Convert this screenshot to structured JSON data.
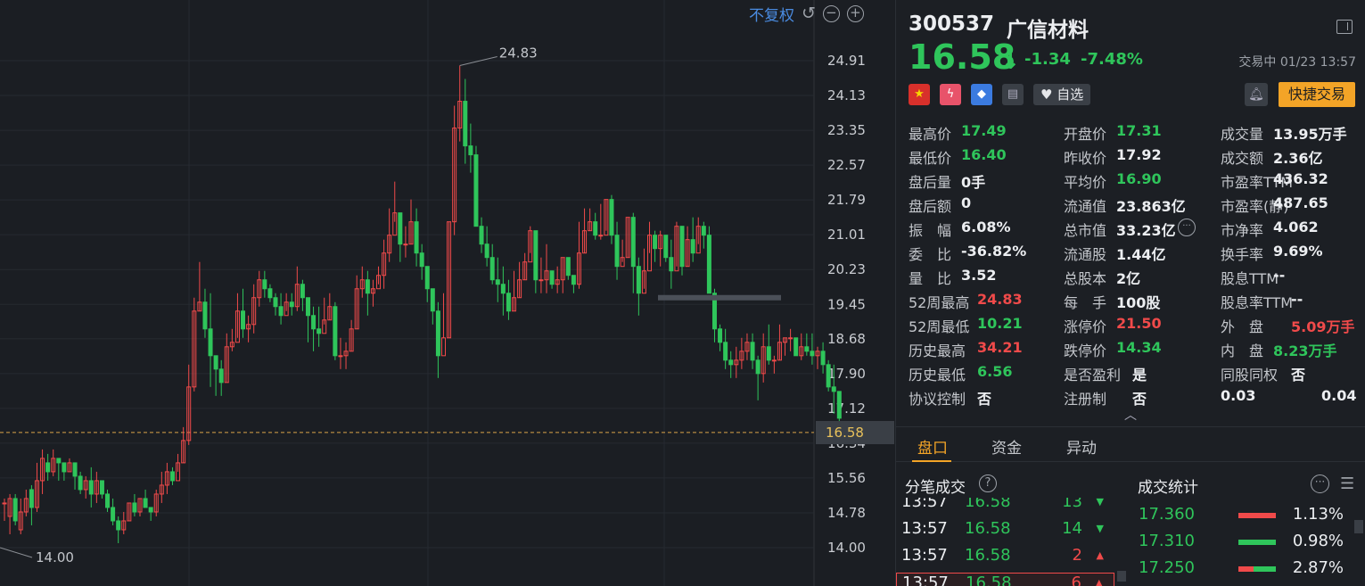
{
  "chart": {
    "adjust_label": "不复权",
    "y_ticks": [
      "24.91",
      "24.13",
      "23.35",
      "22.57",
      "21.79",
      "21.01",
      "20.23",
      "19.45",
      "18.68",
      "17.90",
      "17.12",
      "16.34",
      "15.56",
      "14.78",
      "14.00"
    ],
    "current_price_tag": "16.58",
    "high_annot": "24.83",
    "low_annot": "14.00",
    "up_color": "#f04a4a",
    "down_color": "#2fc55b"
  },
  "chart_data": {
    "type": "candlestick",
    "y_range": [
      14.0,
      24.91
    ],
    "candles": [
      [
        15.0,
        15.0,
        14.6,
        15.1
      ],
      [
        14.7,
        15.1,
        14.3,
        15.2
      ],
      [
        15.1,
        14.6,
        14.5,
        15.2
      ],
      [
        14.4,
        14.8,
        14.3,
        15.1
      ],
      [
        14.8,
        15.1,
        14.7,
        15.3
      ],
      [
        15.3,
        14.9,
        14.5,
        15.4
      ],
      [
        14.9,
        15.5,
        14.8,
        15.9
      ],
      [
        15.5,
        16.0,
        15.2,
        16.2
      ],
      [
        15.9,
        15.7,
        15.5,
        16.1
      ],
      [
        15.7,
        16.0,
        15.6,
        16.2
      ],
      [
        16.0,
        15.9,
        15.5,
        16.0
      ],
      [
        15.9,
        15.7,
        15.5,
        15.9
      ],
      [
        15.7,
        15.9,
        15.7,
        16.0
      ],
      [
        15.9,
        15.6,
        15.3,
        15.9
      ],
      [
        15.6,
        15.3,
        15.2,
        15.7
      ],
      [
        15.3,
        15.5,
        15.1,
        15.6
      ],
      [
        15.5,
        15.2,
        14.9,
        15.8
      ],
      [
        15.2,
        15.5,
        15.0,
        15.7
      ],
      [
        15.5,
        15.2,
        15.1,
        15.5
      ],
      [
        15.2,
        14.9,
        14.8,
        15.3
      ],
      [
        14.9,
        14.6,
        14.5,
        15.1
      ],
      [
        14.6,
        14.4,
        14.1,
        14.7
      ],
      [
        14.4,
        14.6,
        14.3,
        14.8
      ],
      [
        14.6,
        15.0,
        14.6,
        15.0
      ],
      [
        15.0,
        14.8,
        14.7,
        15.2
      ],
      [
        14.8,
        15.1,
        14.7,
        15.1
      ],
      [
        15.1,
        14.9,
        14.9,
        15.3
      ],
      [
        14.9,
        14.8,
        14.6,
        14.9
      ],
      [
        14.8,
        15.2,
        14.7,
        15.3
      ],
      [
        15.2,
        15.4,
        15.0,
        15.7
      ],
      [
        15.4,
        15.7,
        15.2,
        15.9
      ],
      [
        15.7,
        15.5,
        15.4,
        15.8
      ],
      [
        15.5,
        15.9,
        15.7,
        16.1
      ],
      [
        15.9,
        16.4,
        15.9,
        16.7
      ],
      [
        16.4,
        17.6,
        16.3,
        18.1
      ],
      [
        17.6,
        19.3,
        17.5,
        19.6
      ],
      [
        19.3,
        19.5,
        19.3,
        20.4
      ],
      [
        19.5,
        18.9,
        18.7,
        19.8
      ],
      [
        18.9,
        18.3,
        17.6,
        19.7
      ],
      [
        18.3,
        18.0,
        17.4,
        18.3
      ],
      [
        18.0,
        17.7,
        17.4,
        18.2
      ],
      [
        17.7,
        18.5,
        17.7,
        18.8
      ],
      [
        18.5,
        18.6,
        18.4,
        18.9
      ],
      [
        18.6,
        19.3,
        18.7,
        19.7
      ],
      [
        19.3,
        18.9,
        18.7,
        19.8
      ],
      [
        18.9,
        19.0,
        18.6,
        19.2
      ],
      [
        19.0,
        19.6,
        18.8,
        19.9
      ],
      [
        19.6,
        20.0,
        19.4,
        20.2
      ],
      [
        20.0,
        19.8,
        19.6,
        20.2
      ],
      [
        19.8,
        19.6,
        19.5,
        19.9
      ],
      [
        19.6,
        19.4,
        19.2,
        19.7
      ],
      [
        19.4,
        19.2,
        19.0,
        19.7
      ],
      [
        19.2,
        19.5,
        19.3,
        19.7
      ],
      [
        19.5,
        19.4,
        19.2,
        19.7
      ],
      [
        19.4,
        19.9,
        19.3,
        20.3
      ],
      [
        19.9,
        19.6,
        19.3,
        20.0
      ],
      [
        19.6,
        19.2,
        18.6,
        19.6
      ],
      [
        19.2,
        18.9,
        18.4,
        19.4
      ],
      [
        18.9,
        18.8,
        18.5,
        19.4
      ],
      [
        18.8,
        19.1,
        19.0,
        19.6
      ],
      [
        19.1,
        19.4,
        19.1,
        19.7
      ],
      [
        19.4,
        18.3,
        18.2,
        19.5
      ],
      [
        18.3,
        18.3,
        18.0,
        18.7
      ],
      [
        18.3,
        18.4,
        18.0,
        18.6
      ],
      [
        18.4,
        18.9,
        18.4,
        19.1
      ],
      [
        18.9,
        19.8,
        18.9,
        20.1
      ],
      [
        19.8,
        20.0,
        19.6,
        20.3
      ],
      [
        20.0,
        19.7,
        19.2,
        20.2
      ],
      [
        19.7,
        19.8,
        19.4,
        20.0
      ],
      [
        19.8,
        20.1,
        19.9,
        20.3
      ],
      [
        20.1,
        20.6,
        19.8,
        20.9
      ],
      [
        20.6,
        21.0,
        20.4,
        21.6
      ],
      [
        21.0,
        21.5,
        21.3,
        22.2
      ],
      [
        21.5,
        20.8,
        20.4,
        21.5
      ],
      [
        20.8,
        20.8,
        20.5,
        21.2
      ],
      [
        20.8,
        21.3,
        20.8,
        21.8
      ],
      [
        21.3,
        20.6,
        20.3,
        21.6
      ],
      [
        20.6,
        20.3,
        20.0,
        20.8
      ],
      [
        20.3,
        19.8,
        19.5,
        20.3
      ],
      [
        19.8,
        19.3,
        19.0,
        19.8
      ],
      [
        19.3,
        18.3,
        17.8,
        19.5
      ],
      [
        18.3,
        18.7,
        18.7,
        19.7
      ],
      [
        18.7,
        21.3,
        18.7,
        21.3
      ],
      [
        21.3,
        23.4,
        21.0,
        23.9
      ],
      [
        23.4,
        24.0,
        23.1,
        24.8
      ],
      [
        24.0,
        23.0,
        22.6,
        24.5
      ],
      [
        23.0,
        22.8,
        22.4,
        23.5
      ],
      [
        22.8,
        21.2,
        21.2,
        23.0
      ],
      [
        21.2,
        20.8,
        20.6,
        21.4
      ],
      [
        20.8,
        20.5,
        20.3,
        21.2
      ],
      [
        20.5,
        20.0,
        19.9,
        20.8
      ],
      [
        20.0,
        19.9,
        19.5,
        20.5
      ],
      [
        19.9,
        19.7,
        19.2,
        20.3
      ],
      [
        19.7,
        19.3,
        19.1,
        20.0
      ],
      [
        19.3,
        19.6,
        19.3,
        20.2
      ],
      [
        19.6,
        20.0,
        19.6,
        20.4
      ],
      [
        20.0,
        20.4,
        20.0,
        20.6
      ],
      [
        20.4,
        21.1,
        20.6,
        21.2
      ],
      [
        21.1,
        20.0,
        19.7,
        21.1
      ],
      [
        20.0,
        20.0,
        19.7,
        20.5
      ],
      [
        20.0,
        20.2,
        19.7,
        20.8
      ],
      [
        20.2,
        19.9,
        19.8,
        20.2
      ],
      [
        19.9,
        20.0,
        19.7,
        20.3
      ],
      [
        20.0,
        20.5,
        19.7,
        20.5
      ],
      [
        20.5,
        20.1,
        20.0,
        20.5
      ],
      [
        20.1,
        19.9,
        19.7,
        20.1
      ],
      [
        19.9,
        20.6,
        19.8,
        21.3
      ],
      [
        20.6,
        21.1,
        20.6,
        21.6
      ],
      [
        21.1,
        21.3,
        21.1,
        21.6
      ],
      [
        21.3,
        21.0,
        20.9,
        21.5
      ],
      [
        21.0,
        21.0,
        20.9,
        21.7
      ],
      [
        21.0,
        21.8,
        21.1,
        21.8
      ],
      [
        21.8,
        21.0,
        20.8,
        21.9
      ],
      [
        21.0,
        20.3,
        20.0,
        21.3
      ],
      [
        20.3,
        20.5,
        20.4,
        20.9
      ],
      [
        20.5,
        21.4,
        20.5,
        21.4
      ],
      [
        21.4,
        20.3,
        19.7,
        21.5
      ],
      [
        20.3,
        19.7,
        19.2,
        20.5
      ],
      [
        19.7,
        20.2,
        19.8,
        20.7
      ],
      [
        20.2,
        21.0,
        20.6,
        21.3
      ],
      [
        21.0,
        20.7,
        20.4,
        21.1
      ],
      [
        20.7,
        21.0,
        20.3,
        21.1
      ],
      [
        21.0,
        20.5,
        20.4,
        21.0
      ],
      [
        20.5,
        20.2,
        19.8,
        20.9
      ],
      [
        20.2,
        21.2,
        20.3,
        21.3
      ],
      [
        21.2,
        20.3,
        20.1,
        21.2
      ],
      [
        20.3,
        20.9,
        20.3,
        21.2
      ],
      [
        20.9,
        20.6,
        20.4,
        21.4
      ],
      [
        20.6,
        21.2,
        20.8,
        21.4
      ],
      [
        21.2,
        21.0,
        20.7,
        21.3
      ],
      [
        21.0,
        19.7,
        19.7,
        21.2
      ],
      [
        19.7,
        18.9,
        18.6,
        19.8
      ],
      [
        18.9,
        18.6,
        18.4,
        19.0
      ],
      [
        18.6,
        18.2,
        18.0,
        18.9
      ],
      [
        18.2,
        18.1,
        17.8,
        18.4
      ],
      [
        18.1,
        18.2,
        17.8,
        18.5
      ],
      [
        18.2,
        18.4,
        18.0,
        18.7
      ],
      [
        18.4,
        18.6,
        18.2,
        18.8
      ],
      [
        18.6,
        18.2,
        18.0,
        18.8
      ],
      [
        18.2,
        17.9,
        17.3,
        18.3
      ],
      [
        17.9,
        18.5,
        17.7,
        18.8
      ],
      [
        18.5,
        18.2,
        18.1,
        19.0
      ],
      [
        18.2,
        18.2,
        17.9,
        18.3
      ],
      [
        18.2,
        18.6,
        18.2,
        19.0
      ],
      [
        18.6,
        18.7,
        18.3,
        18.7
      ],
      [
        18.7,
        18.7,
        18.4,
        18.9
      ],
      [
        18.7,
        18.3,
        18.3,
        18.7
      ],
      [
        18.3,
        18.5,
        18.2,
        18.8
      ],
      [
        18.5,
        18.4,
        18.3,
        18.8
      ],
      [
        18.4,
        18.3,
        18.1,
        18.8
      ],
      [
        18.3,
        18.4,
        18.0,
        18.5
      ],
      [
        18.4,
        18.1,
        17.9,
        18.6
      ],
      [
        18.1,
        17.6,
        17.5,
        18.2
      ],
      [
        17.6,
        17.5,
        17.0,
        18.1
      ],
      [
        17.5,
        16.9,
        16.4,
        17.5
      ]
    ]
  },
  "stock": {
    "code": "300537",
    "name": "广信材料",
    "price": "16.58",
    "change": "-1.34",
    "change_pct": "-7.48%",
    "status": "交易中 01/23 13:57",
    "watch_label": "自选",
    "quick_trade_label": "快捷交易"
  },
  "stats": [
    [
      {
        "l": "最高价",
        "v": "17.49",
        "c": "g"
      },
      {
        "l": "开盘价",
        "v": "17.31",
        "c": "g"
      },
      {
        "l": "成交量",
        "v": "13.95万手",
        "c": ""
      }
    ],
    [
      {
        "l": "最低价",
        "v": "16.40",
        "c": "g"
      },
      {
        "l": "昨收价",
        "v": "17.92",
        "c": ""
      },
      {
        "l": "成交额",
        "v": "2.36亿",
        "c": ""
      }
    ],
    [
      {
        "l": "盘后量",
        "v": "0手",
        "c": ""
      },
      {
        "l": "平均价",
        "v": "16.90",
        "c": "g"
      },
      {
        "l": "市盈率TTM",
        "v": "436.32",
        "c": ""
      }
    ],
    [
      {
        "l": "盘后额",
        "v": "0",
        "c": ""
      },
      {
        "l": "流通值",
        "v": "23.863亿",
        "c": ""
      },
      {
        "l": "市盈率(静)",
        "v": "487.65",
        "c": ""
      }
    ],
    [
      {
        "l": "振　幅",
        "v": "6.08%",
        "c": ""
      },
      {
        "l": "总市值",
        "v": "33.23亿",
        "c": ""
      },
      {
        "l": "市净率",
        "v": "4.062",
        "c": ""
      }
    ],
    [
      {
        "l": "委　比",
        "v": "-36.82%",
        "c": ""
      },
      {
        "l": "流通股",
        "v": "1.44亿",
        "c": ""
      },
      {
        "l": "换手率",
        "v": "9.69%",
        "c": ""
      }
    ],
    [
      {
        "l": "量　比",
        "v": "3.52",
        "c": ""
      },
      {
        "l": "总股本",
        "v": "2亿",
        "c": ""
      },
      {
        "l": "股息TTM",
        "v": "--",
        "c": ""
      }
    ],
    [
      {
        "l": "52周最高",
        "v": "24.83",
        "c": "r"
      },
      {
        "l": "每　手",
        "v": "100股",
        "c": ""
      },
      {
        "l": "股息率TTM",
        "v": "--",
        "c": ""
      }
    ],
    [
      {
        "l": "52周最低",
        "v": "10.21",
        "c": "g"
      },
      {
        "l": "涨停价",
        "v": "21.50",
        "c": "r"
      },
      {
        "l": "外　盘",
        "v": "5.09万手",
        "c": "r"
      }
    ],
    [
      {
        "l": "历史最高",
        "v": "34.21",
        "c": "r"
      },
      {
        "l": "跌停价",
        "v": "14.34",
        "c": "g"
      },
      {
        "l": "内　盘",
        "v": "8.23万手",
        "c": "g"
      }
    ],
    [
      {
        "l": "历史最低",
        "v": "6.56",
        "c": "g"
      },
      {
        "l": "是否盈利",
        "v": "是",
        "c": ""
      },
      {
        "l": "同股同权",
        "v": "否",
        "c": ""
      }
    ],
    [
      {
        "l": "协议控制",
        "v": "否",
        "c": ""
      },
      {
        "l": "注册制",
        "v": "否",
        "c": ""
      },
      {
        "l": "0.03",
        "v": "0.04",
        "c": ""
      }
    ]
  ],
  "tabs": [
    "盘口",
    "资金",
    "异动"
  ],
  "ticks_title": "分笔成交",
  "stats_title": "成交统计",
  "ticks": [
    {
      "t": "13:57",
      "p": "16.58",
      "q": "13",
      "d": "down"
    },
    {
      "t": "13:57",
      "p": "16.58",
      "q": "14",
      "d": "down"
    },
    {
      "t": "13:57",
      "p": "16.58",
      "q": "2",
      "d": "up"
    },
    {
      "t": "13:57",
      "p": "16.58",
      "q": "6",
      "d": "up"
    }
  ],
  "trade_stats": [
    {
      "price": "17.360",
      "pct": "1.13%",
      "buy": 1.0,
      "sell": 0
    },
    {
      "price": "17.310",
      "pct": "0.98%",
      "buy": 0,
      "sell": 1.0
    },
    {
      "price": "17.250",
      "pct": "2.87%",
      "buy": 0.4,
      "sell": 0.6
    }
  ]
}
